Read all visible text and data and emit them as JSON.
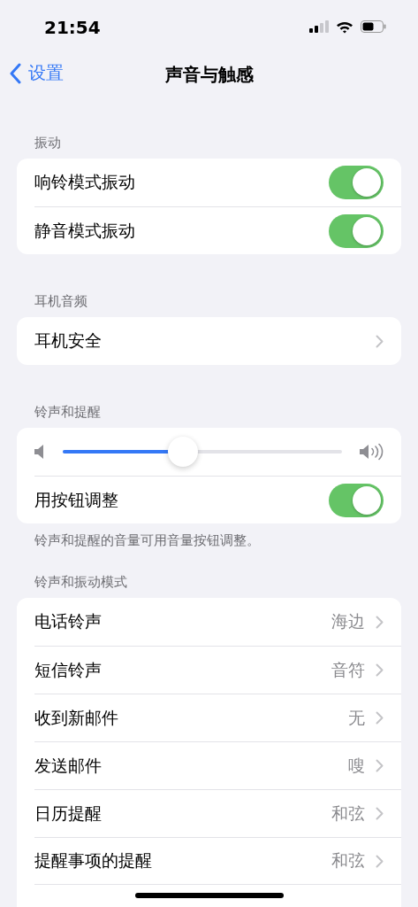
{
  "status_bar": {
    "time": "21:54"
  },
  "nav": {
    "back_label": "设置",
    "title": "声音与触感"
  },
  "sections": [
    {
      "header": "振动",
      "rows": [
        {
          "kind": "toggle",
          "label": "响铃模式振动",
          "on": true
        },
        {
          "kind": "toggle",
          "label": "静音模式振动",
          "on": true
        }
      ]
    },
    {
      "header": "耳机音频",
      "rows": [
        {
          "kind": "link",
          "label": "耳机安全"
        }
      ]
    },
    {
      "header": "铃声和提醒",
      "rows": [
        {
          "kind": "slider",
          "level": 0.43
        },
        {
          "kind": "toggle",
          "label": "用按钮调整",
          "on": true
        }
      ],
      "footer": "铃声和提醒的音量可用音量按钮调整。"
    },
    {
      "header": "铃声和振动模式",
      "rows": [
        {
          "kind": "link",
          "label": "电话铃声",
          "value": "海边"
        },
        {
          "kind": "link",
          "label": "短信铃声",
          "value": "音符"
        },
        {
          "kind": "link",
          "label": "收到新邮件",
          "value": "无"
        },
        {
          "kind": "link",
          "label": "发送邮件",
          "value": "嗖"
        },
        {
          "kind": "link",
          "label": "日历提醒",
          "value": "和弦"
        },
        {
          "kind": "link",
          "label": "提醒事项的提醒",
          "value": "和弦"
        }
      ]
    }
  ]
}
